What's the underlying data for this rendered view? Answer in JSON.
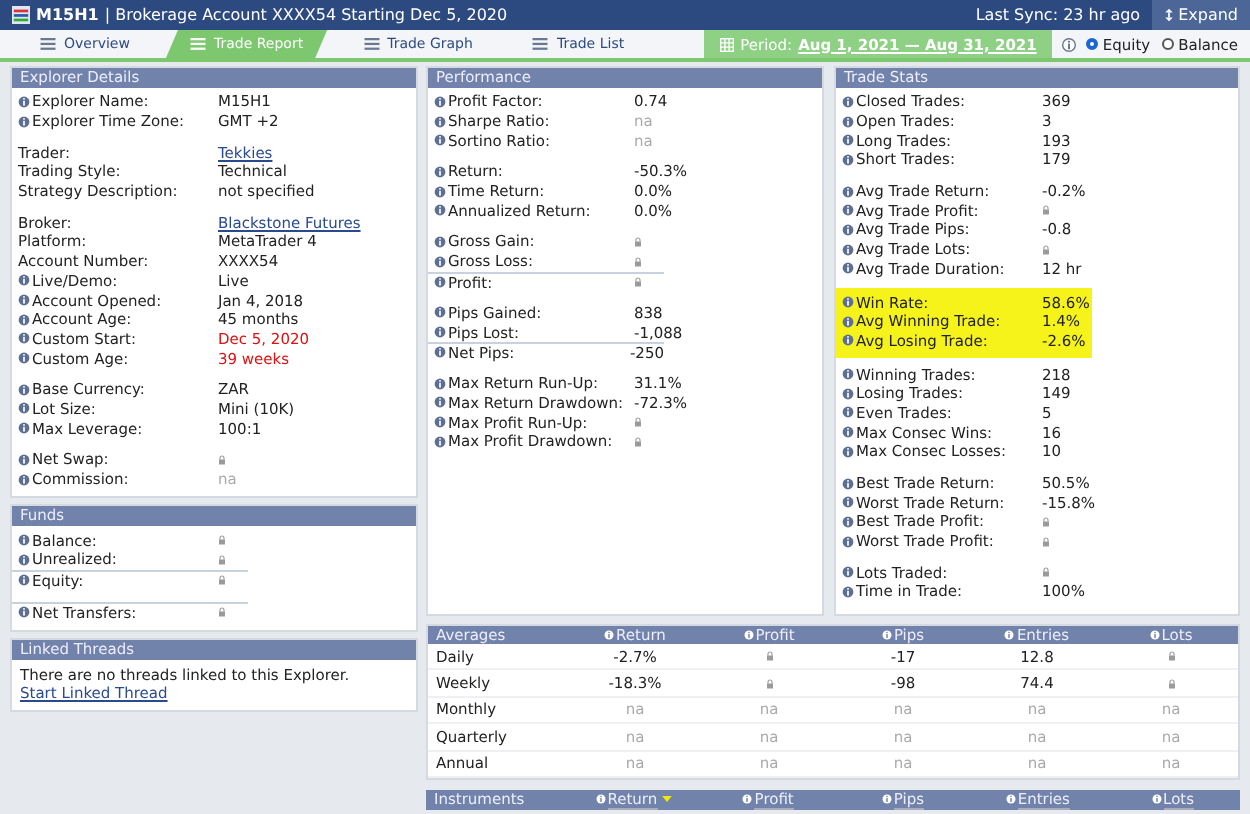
{
  "header": {
    "account": "M15H1",
    "subtitle": "| Brokerage Account XXXX54 Starting Dec 5, 2020",
    "sync": "Last Sync: 23 hr ago",
    "expand": "Expand"
  },
  "tabs": [
    {
      "label": "Overview",
      "selected": false
    },
    {
      "label": "Trade Report",
      "selected": true
    },
    {
      "label": "Trade Graph",
      "selected": false
    },
    {
      "label": "Trade List",
      "selected": false
    }
  ],
  "period": {
    "label": "Period:",
    "range": "Aug 1, 2021 — Aug 31, 2021",
    "options": [
      {
        "label": "Equity",
        "selected": true
      },
      {
        "label": "Balance",
        "selected": false
      }
    ]
  },
  "explorer_details": {
    "title": "Explorer Details",
    "groups": [
      {
        "highlighted": false,
        "total_row": false,
        "rows": [
          {
            "label": "Explorer Name:",
            "info": true,
            "value": {
              "kind": "text",
              "text": "M15H1"
            }
          },
          {
            "label": "Explorer Time Zone:",
            "info": true,
            "value": {
              "kind": "text",
              "text": "GMT +2"
            }
          }
        ]
      },
      {
        "highlighted": false,
        "total_row": false,
        "rows": [
          {
            "label": "Trader:",
            "info": false,
            "value": {
              "kind": "link",
              "text": "Tekkies"
            }
          },
          {
            "label": "Trading Style:",
            "info": false,
            "value": {
              "kind": "text",
              "text": "Technical"
            }
          },
          {
            "label": "Strategy Description:",
            "info": false,
            "value": {
              "kind": "text",
              "text": "not specified"
            }
          }
        ]
      },
      {
        "highlighted": false,
        "total_row": false,
        "rows": [
          {
            "label": "Broker:",
            "info": false,
            "value": {
              "kind": "link",
              "text": "Blackstone Futures"
            }
          },
          {
            "label": "Platform:",
            "info": false,
            "value": {
              "kind": "text",
              "text": "MetaTrader 4"
            }
          },
          {
            "label": "Account Number:",
            "info": false,
            "value": {
              "kind": "text",
              "text": "XXXX54"
            }
          },
          {
            "label": "Live/Demo:",
            "info": true,
            "value": {
              "kind": "text",
              "text": "Live"
            }
          },
          {
            "label": "Account Opened:",
            "info": true,
            "value": {
              "kind": "text",
              "text": "Jan 4, 2018"
            }
          },
          {
            "label": "Account Age:",
            "info": true,
            "value": {
              "kind": "text",
              "text": "45 months"
            }
          },
          {
            "label": "Custom Start:",
            "info": true,
            "value": {
              "kind": "alert",
              "text": "Dec 5, 2020"
            }
          },
          {
            "label": "Custom Age:",
            "info": true,
            "value": {
              "kind": "alert",
              "text": "39 weeks"
            }
          }
        ]
      },
      {
        "highlighted": false,
        "total_row": false,
        "rows": [
          {
            "label": "Base Currency:",
            "info": true,
            "value": {
              "kind": "text",
              "text": "ZAR"
            }
          },
          {
            "label": "Lot Size:",
            "info": true,
            "value": {
              "kind": "text",
              "text": "Mini (10K)"
            }
          },
          {
            "label": "Max Leverage:",
            "info": true,
            "value": {
              "kind": "text",
              "text": "100:1"
            }
          }
        ]
      },
      {
        "highlighted": false,
        "total_row": false,
        "rows": [
          {
            "label": "Net Swap:",
            "info": true,
            "value": {
              "kind": "locked"
            }
          },
          {
            "label": "Commission:",
            "info": true,
            "value": {
              "kind": "na",
              "text": "na"
            }
          }
        ]
      }
    ]
  },
  "funds": {
    "title": "Funds",
    "groups": [
      {
        "highlighted": false,
        "total_row": true,
        "rows": [
          {
            "label": "Balance:",
            "info": true,
            "value": {
              "kind": "locked"
            }
          },
          {
            "label": "Unrealized:",
            "info": true,
            "value": {
              "kind": "locked"
            }
          },
          {
            "label": "Equity:",
            "info": true,
            "value": {
              "kind": "locked"
            }
          }
        ]
      },
      {
        "highlighted": false,
        "total_row": true,
        "rows": [
          {
            "label": "Net Transfers:",
            "info": true,
            "value": {
              "kind": "locked"
            }
          }
        ]
      }
    ]
  },
  "linked_threads": {
    "title": "Linked Threads",
    "message": "There are no threads linked to this Explorer.",
    "link": "Start Linked Thread"
  },
  "performance": {
    "title": "Performance",
    "groups": [
      {
        "highlighted": false,
        "total_row": false,
        "rows": [
          {
            "label": "Profit Factor:",
            "info": true,
            "value": {
              "kind": "text",
              "text": "0.74"
            }
          },
          {
            "label": "Sharpe Ratio:",
            "info": true,
            "value": {
              "kind": "na",
              "text": "na"
            }
          },
          {
            "label": "Sortino Ratio:",
            "info": true,
            "value": {
              "kind": "na",
              "text": "na"
            }
          }
        ]
      },
      {
        "highlighted": false,
        "total_row": false,
        "rows": [
          {
            "label": "Return:",
            "info": true,
            "value": {
              "kind": "text",
              "text": "-50.3%"
            }
          },
          {
            "label": "Time Return:",
            "info": true,
            "value": {
              "kind": "text",
              "text": "0.0%"
            }
          },
          {
            "label": "Annualized Return:",
            "info": true,
            "value": {
              "kind": "text",
              "text": "0.0%"
            }
          }
        ]
      },
      {
        "highlighted": false,
        "total_row": true,
        "rows": [
          {
            "label": "Gross Gain:",
            "info": true,
            "value": {
              "kind": "locked"
            }
          },
          {
            "label": "Gross Loss:",
            "info": true,
            "value": {
              "kind": "locked"
            }
          },
          {
            "label": "Profit:",
            "info": true,
            "value": {
              "kind": "locked"
            }
          }
        ]
      },
      {
        "highlighted": false,
        "total_row": true,
        "rows": [
          {
            "label": "Pips Gained:",
            "info": true,
            "value": {
              "kind": "number",
              "text": "838"
            }
          },
          {
            "label": "Pips Lost:",
            "info": true,
            "value": {
              "kind": "number",
              "text": "-1,088"
            }
          },
          {
            "label": "Net Pips:",
            "info": true,
            "value": {
              "kind": "number",
              "text": "-250"
            }
          }
        ]
      },
      {
        "highlighted": false,
        "total_row": false,
        "rows": [
          {
            "label": "Max Return Run-Up:",
            "info": true,
            "value": {
              "kind": "text",
              "text": "31.1%"
            }
          },
          {
            "label": "Max Return Drawdown:",
            "info": true,
            "value": {
              "kind": "text",
              "text": "-72.3%"
            }
          },
          {
            "label": "Max Profit Run-Up:",
            "info": true,
            "value": {
              "kind": "locked"
            }
          },
          {
            "label": "Max Profit Drawdown:",
            "info": true,
            "value": {
              "kind": "locked"
            }
          }
        ]
      }
    ]
  },
  "trade_stats": {
    "title": "Trade Stats",
    "groups": [
      {
        "highlighted": false,
        "total_row": false,
        "rows": [
          {
            "label": "Closed Trades:",
            "info": true,
            "value": {
              "kind": "text",
              "text": "369"
            }
          },
          {
            "label": "Open Trades:",
            "info": true,
            "value": {
              "kind": "text",
              "text": "3"
            }
          },
          {
            "label": "Long Trades:",
            "info": true,
            "value": {
              "kind": "text",
              "text": "193"
            }
          },
          {
            "label": "Short Trades:",
            "info": true,
            "value": {
              "kind": "text",
              "text": "179"
            }
          }
        ]
      },
      {
        "highlighted": false,
        "total_row": false,
        "rows": [
          {
            "label": "Avg Trade Return:",
            "info": true,
            "value": {
              "kind": "text",
              "text": "-0.2%"
            }
          },
          {
            "label": "Avg Trade Profit:",
            "info": true,
            "value": {
              "kind": "locked"
            }
          },
          {
            "label": "Avg Trade Pips:",
            "info": true,
            "value": {
              "kind": "text",
              "text": "-0.8"
            }
          },
          {
            "label": "Avg Trade Lots:",
            "info": true,
            "value": {
              "kind": "locked"
            }
          },
          {
            "label": "Avg Trade Duration:",
            "info": true,
            "value": {
              "kind": "text",
              "text": "12 hr"
            }
          }
        ]
      },
      {
        "highlighted": true,
        "total_row": false,
        "rows": [
          {
            "label": "Win Rate:",
            "info": true,
            "value": {
              "kind": "text",
              "text": "58.6%"
            }
          },
          {
            "label": "Avg Winning Trade:",
            "info": true,
            "value": {
              "kind": "text",
              "text": "1.4%"
            }
          },
          {
            "label": "Avg Losing Trade:",
            "info": true,
            "value": {
              "kind": "text",
              "text": "-2.6%"
            }
          }
        ]
      },
      {
        "highlighted": false,
        "total_row": false,
        "rows": [
          {
            "label": "Winning Trades:",
            "info": true,
            "value": {
              "kind": "text",
              "text": "218"
            }
          },
          {
            "label": "Losing Trades:",
            "info": true,
            "value": {
              "kind": "text",
              "text": "149"
            }
          },
          {
            "label": "Even Trades:",
            "info": true,
            "value": {
              "kind": "text",
              "text": "5"
            }
          },
          {
            "label": "Max Consec Wins:",
            "info": true,
            "value": {
              "kind": "text",
              "text": "16"
            }
          },
          {
            "label": "Max Consec Losses:",
            "info": true,
            "value": {
              "kind": "text",
              "text": "10"
            }
          }
        ]
      },
      {
        "highlighted": false,
        "total_row": false,
        "rows": [
          {
            "label": "Best Trade Return:",
            "info": true,
            "value": {
              "kind": "text",
              "text": "50.5%"
            }
          },
          {
            "label": "Worst Trade Return:",
            "info": true,
            "value": {
              "kind": "text",
              "text": "-15.8%"
            }
          },
          {
            "label": "Best Trade Profit:",
            "info": true,
            "value": {
              "kind": "locked"
            }
          },
          {
            "label": "Worst Trade Profit:",
            "info": true,
            "value": {
              "kind": "locked"
            }
          }
        ]
      },
      {
        "highlighted": false,
        "total_row": false,
        "rows": [
          {
            "label": "Lots Traded:",
            "info": true,
            "value": {
              "kind": "locked"
            }
          },
          {
            "label": "Time in Trade:",
            "info": true,
            "value": {
              "kind": "text",
              "text": "100%"
            }
          }
        ]
      }
    ]
  },
  "averages": {
    "title": "Averages",
    "columns": [
      {
        "label": "Return",
        "info": true
      },
      {
        "label": "Profit",
        "info": true
      },
      {
        "label": "Pips",
        "info": true
      },
      {
        "label": "Entries",
        "info": true
      },
      {
        "label": "Lots",
        "info": true
      }
    ],
    "rows": [
      {
        "label": "Daily",
        "cells": [
          {
            "kind": "text",
            "text": "-2.7%"
          },
          {
            "kind": "locked"
          },
          {
            "kind": "text",
            "text": "-17"
          },
          {
            "kind": "text",
            "text": "12.8"
          },
          {
            "kind": "locked"
          }
        ]
      },
      {
        "label": "Weekly",
        "cells": [
          {
            "kind": "text",
            "text": "-18.3%"
          },
          {
            "kind": "locked"
          },
          {
            "kind": "text",
            "text": "-98"
          },
          {
            "kind": "text",
            "text": "74.4"
          },
          {
            "kind": "locked"
          }
        ]
      },
      {
        "label": "Monthly",
        "cells": [
          {
            "kind": "na",
            "text": "na"
          },
          {
            "kind": "na",
            "text": "na"
          },
          {
            "kind": "na",
            "text": "na"
          },
          {
            "kind": "na",
            "text": "na"
          },
          {
            "kind": "na",
            "text": "na"
          }
        ]
      },
      {
        "label": "Quarterly",
        "cells": [
          {
            "kind": "na",
            "text": "na"
          },
          {
            "kind": "na",
            "text": "na"
          },
          {
            "kind": "na",
            "text": "na"
          },
          {
            "kind": "na",
            "text": "na"
          },
          {
            "kind": "na",
            "text": "na"
          }
        ]
      },
      {
        "label": "Annual",
        "cells": [
          {
            "kind": "na",
            "text": "na"
          },
          {
            "kind": "na",
            "text": "na"
          },
          {
            "kind": "na",
            "text": "na"
          },
          {
            "kind": "na",
            "text": "na"
          },
          {
            "kind": "na",
            "text": "na"
          }
        ]
      }
    ]
  },
  "instruments": {
    "title": "Instruments",
    "columns": [
      {
        "label": "Return",
        "info": true,
        "sorted": true
      },
      {
        "label": "Profit",
        "info": true,
        "sorted": false
      },
      {
        "label": "Pips",
        "info": true,
        "sorted": false
      },
      {
        "label": "Entries",
        "info": true,
        "sorted": false
      },
      {
        "label": "Lots",
        "info": true,
        "sorted": false
      }
    ]
  }
}
